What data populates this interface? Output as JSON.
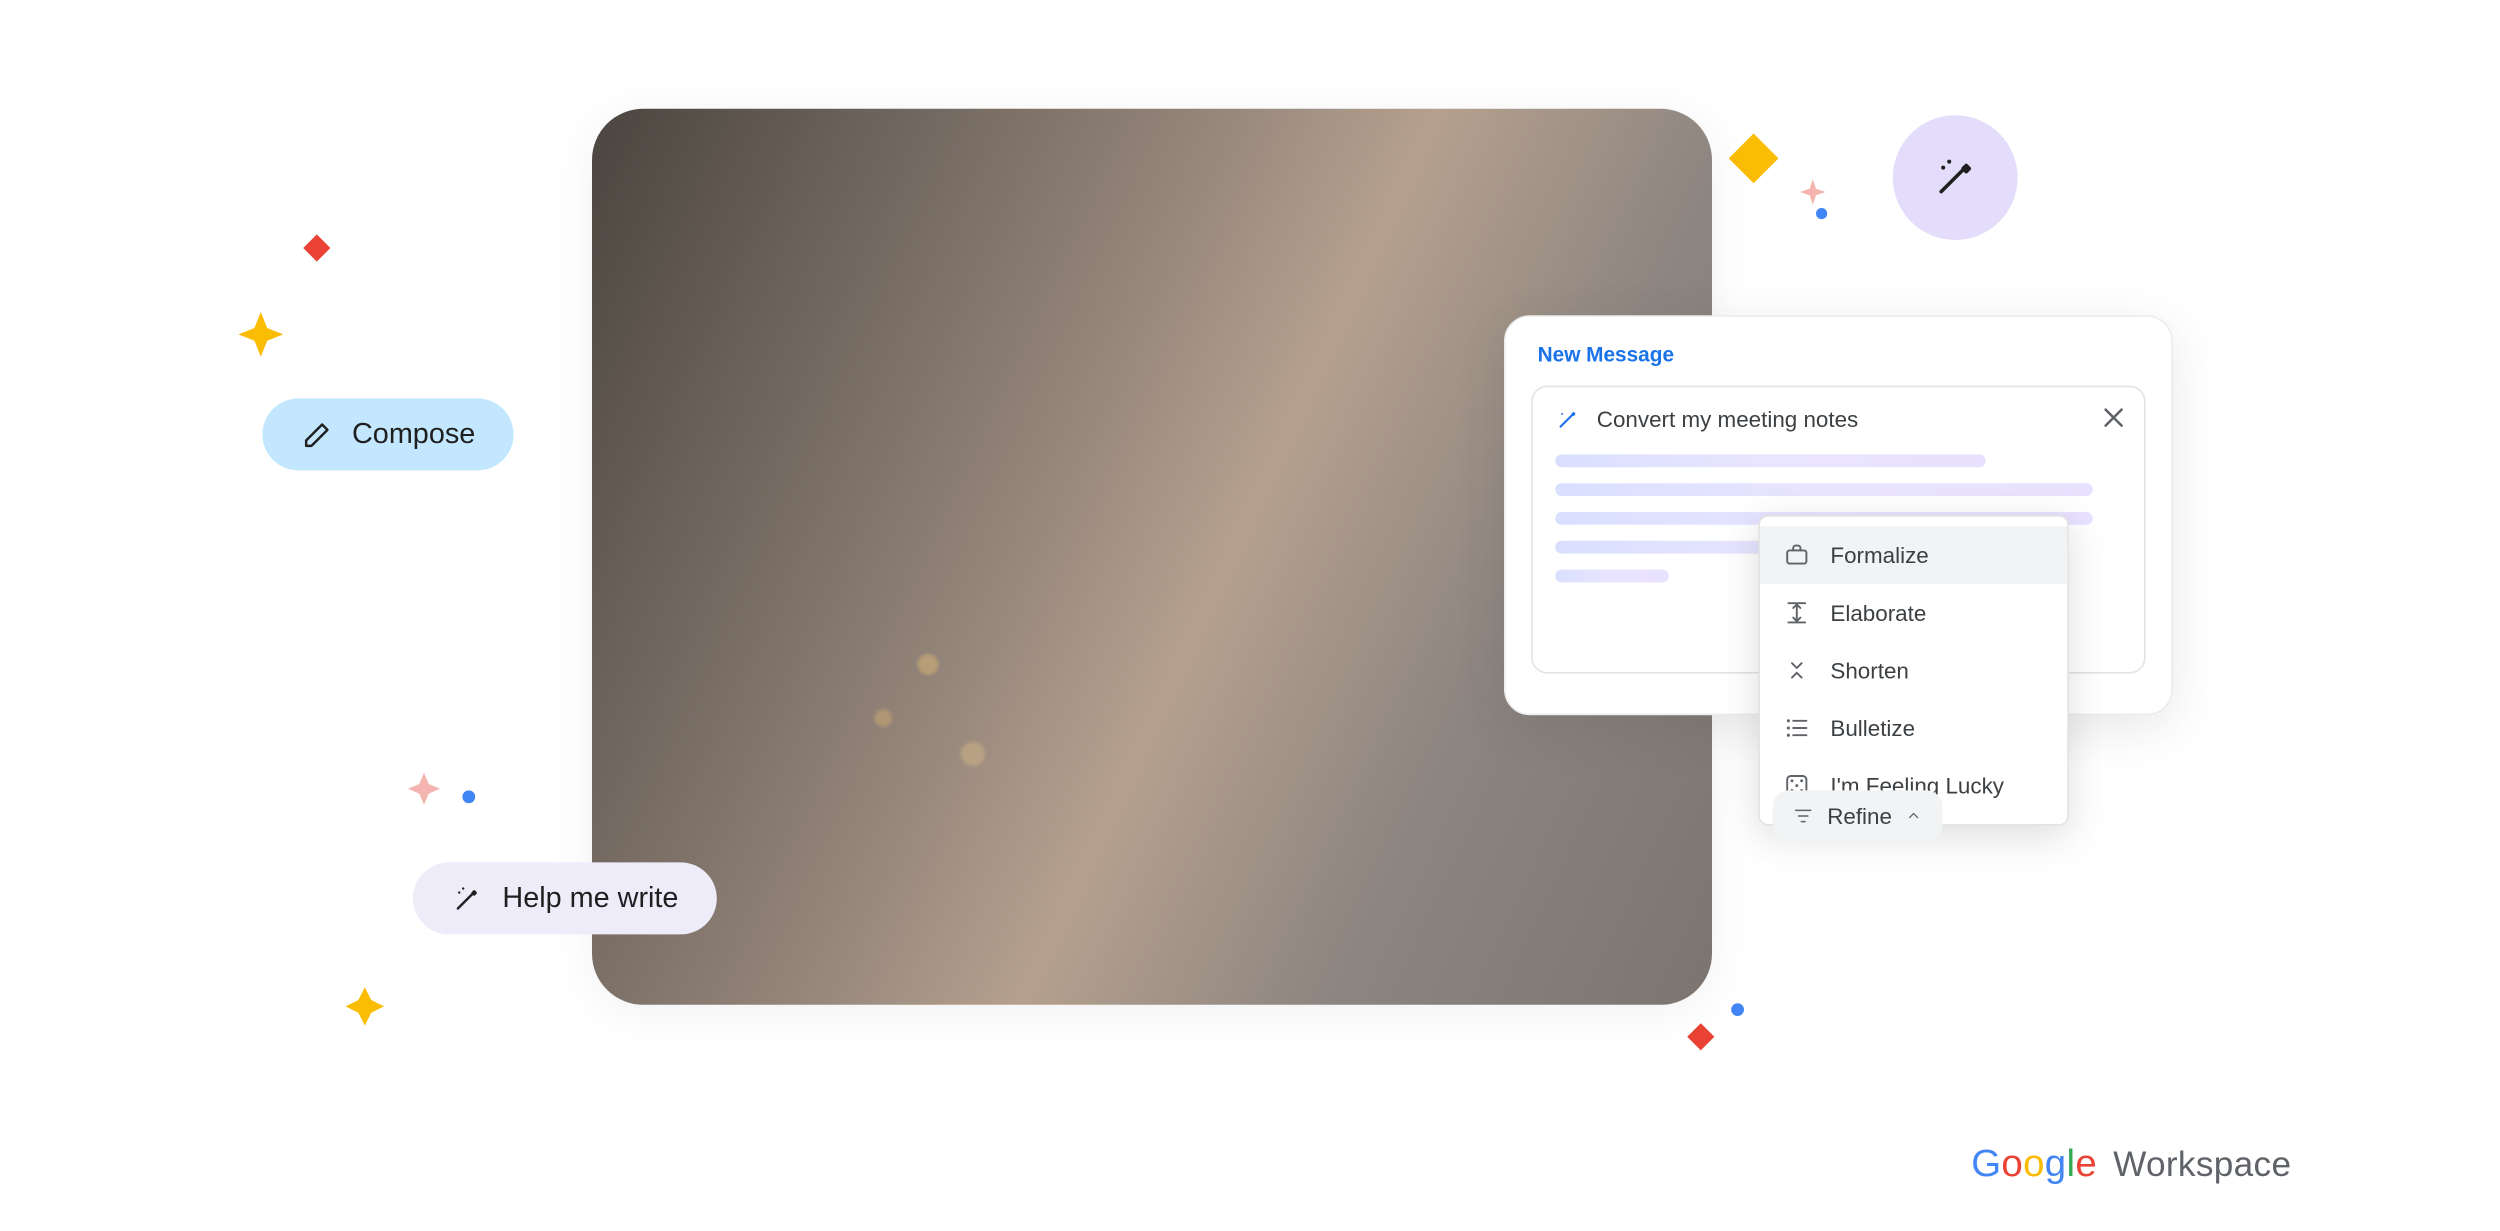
{
  "pills": {
    "compose_label": "Compose",
    "help_label": "Help me write"
  },
  "new_message": {
    "title": "New Message",
    "prompt_text": "Convert my meeting notes"
  },
  "refine": {
    "button_label": "Refine",
    "options": [
      {
        "label": "Formalize",
        "icon": "briefcase"
      },
      {
        "label": "Elaborate",
        "icon": "expand"
      },
      {
        "label": "Shorten",
        "icon": "collapse"
      },
      {
        "label": "Bulletize",
        "icon": "bulleted-list"
      },
      {
        "label": "I'm Feeling Lucky",
        "icon": "dice"
      }
    ]
  },
  "branding": {
    "product": "Workspace"
  },
  "colors": {
    "compose_bg": "#c2e7ff",
    "help_bg": "#efecfa",
    "magic_bg": "#e3dcfb",
    "link_blue": "#1a73e8"
  }
}
